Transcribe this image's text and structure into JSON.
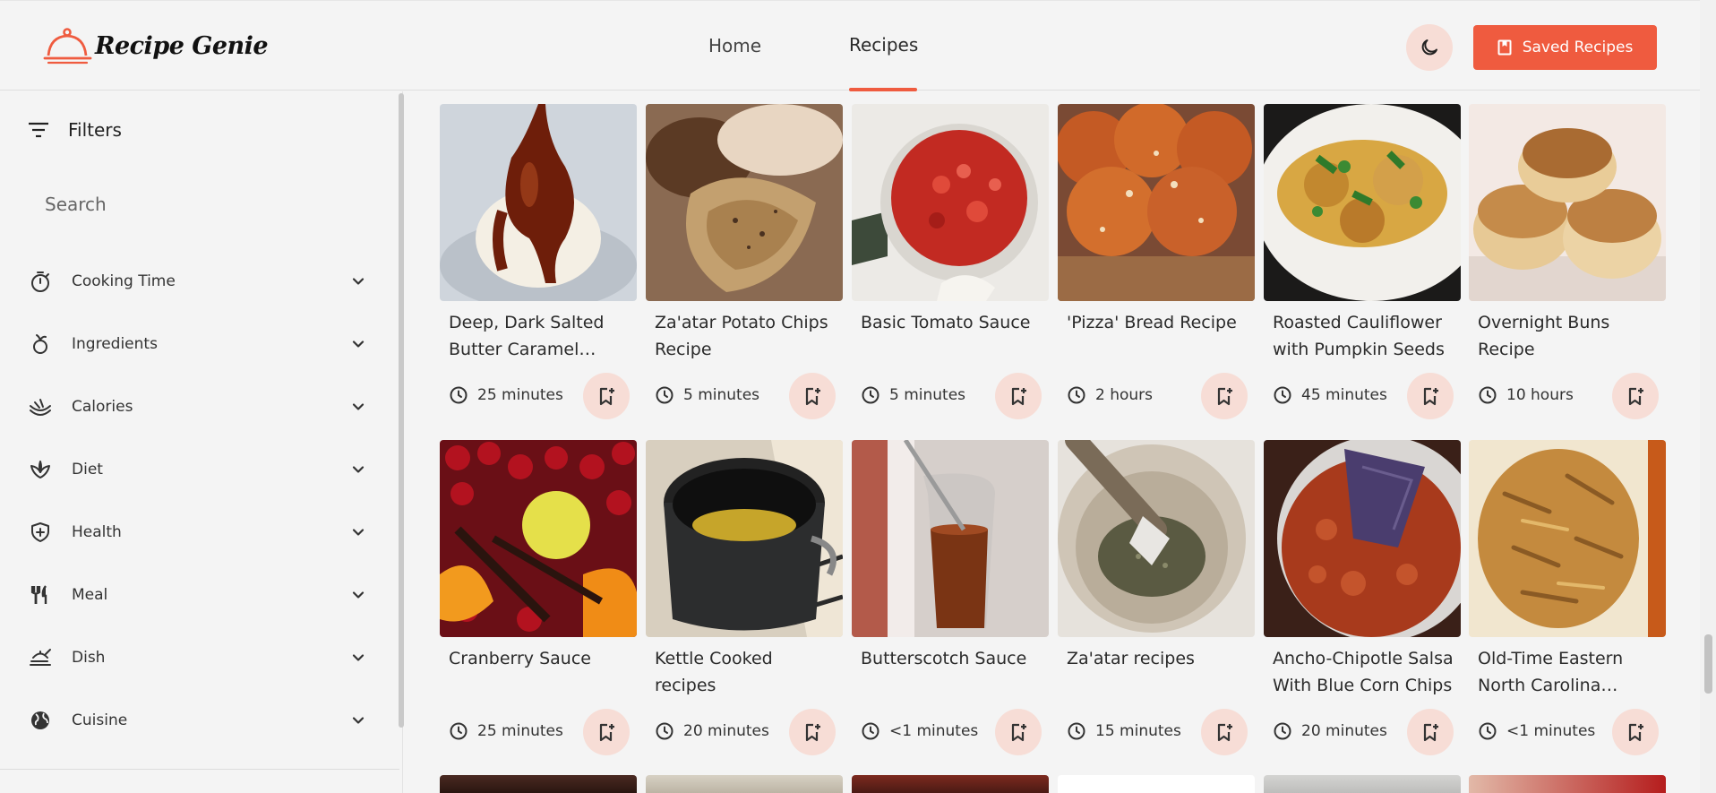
{
  "app": {
    "logo_text": "Recipe Genie"
  },
  "nav": {
    "home": "Home",
    "recipes": "Recipes",
    "saved_recipes": "Saved Recipes"
  },
  "sidebar": {
    "filters_label": "Filters",
    "search_placeholder": "Search",
    "filters": [
      {
        "label": "Cooking Time",
        "icon": "timer-icon"
      },
      {
        "label": "Ingredients",
        "icon": "apple-icon"
      },
      {
        "label": "Calories",
        "icon": "calories-icon"
      },
      {
        "label": "Diet",
        "icon": "leaf-icon"
      },
      {
        "label": "Health",
        "icon": "shield-plus-icon"
      },
      {
        "label": "Meal",
        "icon": "utensils-icon"
      },
      {
        "label": "Dish",
        "icon": "dish-stack-icon"
      },
      {
        "label": "Cuisine",
        "icon": "globe-icon"
      }
    ]
  },
  "recipes": [
    {
      "title": "Deep, Dark Salted Butter Caramel Sauce",
      "time": "25 minutes",
      "image": "caramel sauce on ice cream"
    },
    {
      "title": "Za'atar Potato Chips Recipe",
      "time": "5 minutes",
      "image": "potato chips"
    },
    {
      "title": "Basic Tomato Sauce",
      "time": "5 minutes",
      "image": "tomato sauce in pan"
    },
    {
      "title": "'Pizza' Bread Recipe",
      "time": "2 hours",
      "image": "pizza bread rolls"
    },
    {
      "title": "Roasted Cauliflower with Pumpkin Seeds",
      "time": "45 minutes",
      "image": "roasted cauliflower"
    },
    {
      "title": "Overnight Buns Recipe",
      "time": "10 hours",
      "image": "buns"
    },
    {
      "title": "Cranberry Sauce",
      "time": "25 minutes",
      "image": "cranberries"
    },
    {
      "title": "Kettle Cooked recipes",
      "time": "20 minutes",
      "image": "pot on stove"
    },
    {
      "title": "Butterscotch Sauce",
      "time": "<1 minutes",
      "image": "butterscotch jar"
    },
    {
      "title": "Za'atar recipes",
      "time": "15 minutes",
      "image": "mortar and pestle"
    },
    {
      "title": "Ancho-Chipotle Salsa With Blue Corn Chips",
      "time": "20 minutes",
      "image": "salsa with chips"
    },
    {
      "title": "Old-Time Eastern North Carolina Barbecue",
      "time": "<1 minutes",
      "image": "pulled pork"
    }
  ],
  "colors": {
    "accent": "#ef5b3f",
    "accent_soft": "#f7ddd6",
    "background": "#f4f4f4"
  }
}
